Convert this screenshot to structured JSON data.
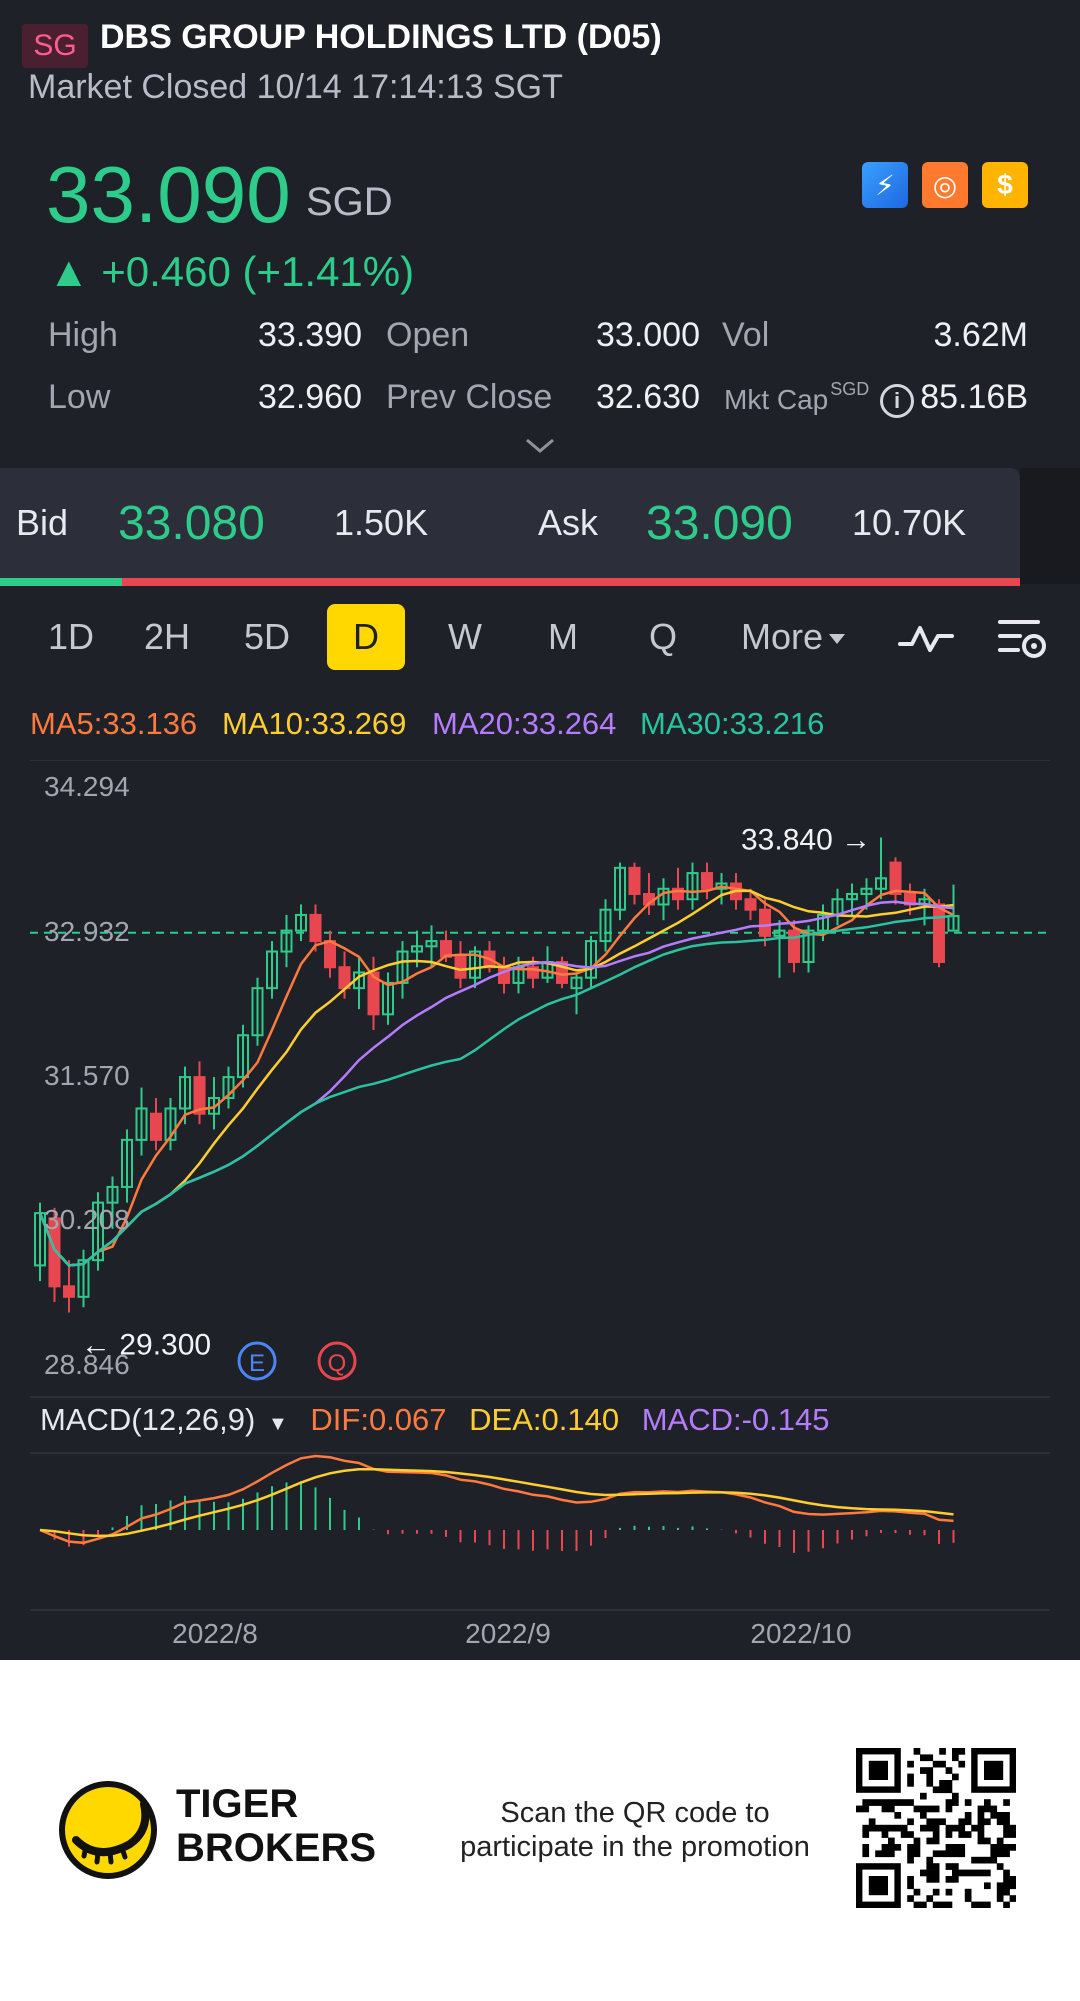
{
  "header": {
    "market_badge": "SG",
    "company": "DBS GROUP HOLDINGS LTD (D05)",
    "status": "Market Closed 10/14 17:14:13 SGT"
  },
  "quote": {
    "price": "33.090",
    "currency": "SGD",
    "change": "▲ +0.460 (+1.41%)",
    "badges": [
      "lightning-icon",
      "exchange-icon",
      "dollar-icon"
    ],
    "badge_glyphs": [
      "⚡",
      "◎",
      "$"
    ]
  },
  "stats": {
    "high_label": "High",
    "high_value": "33.390",
    "open_label": "Open",
    "open_value": "33.000",
    "vol_label": "Vol",
    "vol_value": "3.62M",
    "low_label": "Low",
    "low_value": "32.960",
    "prev_close_label": "Prev Close",
    "prev_close_value": "32.630",
    "mkt_cap_label": "Mkt Cap",
    "mkt_cap_unit": "SGD",
    "mkt_cap_value": "85.16B",
    "info_glyph": "i"
  },
  "bidask": {
    "bid_label": "Bid",
    "bid_price": "33.080",
    "bid_size": "1.50K",
    "ask_label": "Ask",
    "ask_price": "33.090",
    "ask_size": "10.70K",
    "bid_share": 0.12
  },
  "tabs": {
    "items": [
      "1D",
      "2H",
      "5D",
      "D",
      "W",
      "M",
      "Q"
    ],
    "active": "D",
    "more_label": "More"
  },
  "ma": {
    "ma5": "MA5:33.136",
    "ma10": "MA10:33.269",
    "ma20": "MA20:33.264",
    "ma30": "MA30:33.216"
  },
  "macd": {
    "title": "MACD(12,26,9)",
    "dif": "DIF:0.067",
    "dea": "DEA:0.140",
    "macd": "MACD:-0.145"
  },
  "colors": {
    "up": "#2ecc8a",
    "down": "#e8474f",
    "ma5": "#ff7a3d",
    "ma10": "#ffce2e",
    "ma20": "#b67cff",
    "ma30": "#29c3a0",
    "background": "#1f2129"
  },
  "chart_data": {
    "type": "candlestick",
    "y_ticks": [
      "34.294",
      "32.932",
      "31.570",
      "30.208",
      "28.846"
    ],
    "ylim": [
      28.846,
      34.294
    ],
    "x_labels": [
      "2022/8",
      "2022/9",
      "2022/10"
    ],
    "max_label": "33.840",
    "min_label": "29.300",
    "max_value": 33.84,
    "min_value": 29.3,
    "prev_close": 32.93,
    "event_markers": [
      "E",
      "Q"
    ],
    "candles": [
      {
        "o": 29.75,
        "h": 30.35,
        "l": 29.6,
        "c": 30.25
      },
      {
        "o": 30.2,
        "h": 30.3,
        "l": 29.4,
        "c": 29.55
      },
      {
        "o": 29.55,
        "h": 29.8,
        "l": 29.3,
        "c": 29.45
      },
      {
        "o": 29.45,
        "h": 29.9,
        "l": 29.35,
        "c": 29.8
      },
      {
        "o": 29.8,
        "h": 30.45,
        "l": 29.7,
        "c": 30.35
      },
      {
        "o": 30.35,
        "h": 30.6,
        "l": 30.1,
        "c": 30.5
      },
      {
        "o": 30.5,
        "h": 31.05,
        "l": 30.35,
        "c": 30.95
      },
      {
        "o": 30.95,
        "h": 31.45,
        "l": 30.8,
        "c": 31.25
      },
      {
        "o": 31.2,
        "h": 31.35,
        "l": 30.85,
        "c": 30.95
      },
      {
        "o": 30.95,
        "h": 31.35,
        "l": 30.85,
        "c": 31.25
      },
      {
        "o": 31.25,
        "h": 31.65,
        "l": 31.1,
        "c": 31.55
      },
      {
        "o": 31.55,
        "h": 31.7,
        "l": 31.1,
        "c": 31.2
      },
      {
        "o": 31.2,
        "h": 31.55,
        "l": 31.05,
        "c": 31.35
      },
      {
        "o": 31.35,
        "h": 31.65,
        "l": 31.25,
        "c": 31.55
      },
      {
        "o": 31.55,
        "h": 32.05,
        "l": 31.45,
        "c": 31.95
      },
      {
        "o": 31.95,
        "h": 32.5,
        "l": 31.85,
        "c": 32.4
      },
      {
        "o": 32.4,
        "h": 32.85,
        "l": 32.3,
        "c": 32.75
      },
      {
        "o": 32.75,
        "h": 33.1,
        "l": 32.6,
        "c": 32.95
      },
      {
        "o": 32.95,
        "h": 33.2,
        "l": 32.85,
        "c": 33.1
      },
      {
        "o": 33.1,
        "h": 33.2,
        "l": 32.75,
        "c": 32.85
      },
      {
        "o": 32.85,
        "h": 32.95,
        "l": 32.5,
        "c": 32.6
      },
      {
        "o": 32.6,
        "h": 32.75,
        "l": 32.3,
        "c": 32.4
      },
      {
        "o": 32.4,
        "h": 32.7,
        "l": 32.2,
        "c": 32.55
      },
      {
        "o": 32.55,
        "h": 32.7,
        "l": 32.0,
        "c": 32.15
      },
      {
        "o": 32.15,
        "h": 32.55,
        "l": 32.05,
        "c": 32.45
      },
      {
        "o": 32.45,
        "h": 32.85,
        "l": 32.3,
        "c": 32.75
      },
      {
        "o": 32.75,
        "h": 32.95,
        "l": 32.6,
        "c": 32.8
      },
      {
        "o": 32.8,
        "h": 33.0,
        "l": 32.6,
        "c": 32.85
      },
      {
        "o": 32.85,
        "h": 32.95,
        "l": 32.65,
        "c": 32.7
      },
      {
        "o": 32.7,
        "h": 32.85,
        "l": 32.4,
        "c": 32.5
      },
      {
        "o": 32.5,
        "h": 32.8,
        "l": 32.4,
        "c": 32.75
      },
      {
        "o": 32.75,
        "h": 32.85,
        "l": 32.55,
        "c": 32.6
      },
      {
        "o": 32.6,
        "h": 32.7,
        "l": 32.35,
        "c": 32.45
      },
      {
        "o": 32.45,
        "h": 32.7,
        "l": 32.35,
        "c": 32.6
      },
      {
        "o": 32.6,
        "h": 32.7,
        "l": 32.4,
        "c": 32.5
      },
      {
        "o": 32.5,
        "h": 32.8,
        "l": 32.45,
        "c": 32.65
      },
      {
        "o": 32.65,
        "h": 32.7,
        "l": 32.4,
        "c": 32.45
      },
      {
        "o": 32.4,
        "h": 32.55,
        "l": 32.15,
        "c": 32.5
      },
      {
        "o": 32.5,
        "h": 32.9,
        "l": 32.4,
        "c": 32.85
      },
      {
        "o": 32.85,
        "h": 33.25,
        "l": 32.75,
        "c": 33.15
      },
      {
        "o": 33.15,
        "h": 33.6,
        "l": 33.05,
        "c": 33.55
      },
      {
        "o": 33.55,
        "h": 33.6,
        "l": 33.2,
        "c": 33.3
      },
      {
        "o": 33.3,
        "h": 33.5,
        "l": 33.1,
        "c": 33.2
      },
      {
        "o": 33.2,
        "h": 33.45,
        "l": 33.05,
        "c": 33.35
      },
      {
        "o": 33.35,
        "h": 33.55,
        "l": 33.15,
        "c": 33.25
      },
      {
        "o": 33.25,
        "h": 33.6,
        "l": 33.15,
        "c": 33.5
      },
      {
        "o": 33.5,
        "h": 33.6,
        "l": 33.25,
        "c": 33.35
      },
      {
        "o": 33.35,
        "h": 33.5,
        "l": 33.2,
        "c": 33.4
      },
      {
        "o": 33.4,
        "h": 33.5,
        "l": 33.15,
        "c": 33.25
      },
      {
        "o": 33.25,
        "h": 33.35,
        "l": 33.05,
        "c": 33.15
      },
      {
        "o": 33.15,
        "h": 33.25,
        "l": 32.8,
        "c": 32.9
      },
      {
        "o": 32.9,
        "h": 33.05,
        "l": 32.5,
        "c": 32.95
      },
      {
        "o": 32.95,
        "h": 33.05,
        "l": 32.55,
        "c": 32.65
      },
      {
        "o": 32.65,
        "h": 33.0,
        "l": 32.55,
        "c": 32.95
      },
      {
        "o": 32.95,
        "h": 33.2,
        "l": 32.85,
        "c": 33.1
      },
      {
        "o": 33.1,
        "h": 33.35,
        "l": 33.0,
        "c": 33.25
      },
      {
        "o": 33.25,
        "h": 33.4,
        "l": 33.1,
        "c": 33.3
      },
      {
        "o": 33.3,
        "h": 33.45,
        "l": 33.15,
        "c": 33.35
      },
      {
        "o": 33.35,
        "h": 33.84,
        "l": 33.25,
        "c": 33.45
      },
      {
        "o": 33.6,
        "h": 33.65,
        "l": 33.2,
        "c": 33.3
      },
      {
        "o": 33.3,
        "h": 33.4,
        "l": 33.1,
        "c": 33.2
      },
      {
        "o": 33.2,
        "h": 33.35,
        "l": 33.0,
        "c": 33.25
      },
      {
        "o": 33.2,
        "h": 33.25,
        "l": 32.6,
        "c": 32.65
      },
      {
        "o": 32.95,
        "h": 33.39,
        "l": 32.96,
        "c": 33.09
      }
    ]
  }
}
